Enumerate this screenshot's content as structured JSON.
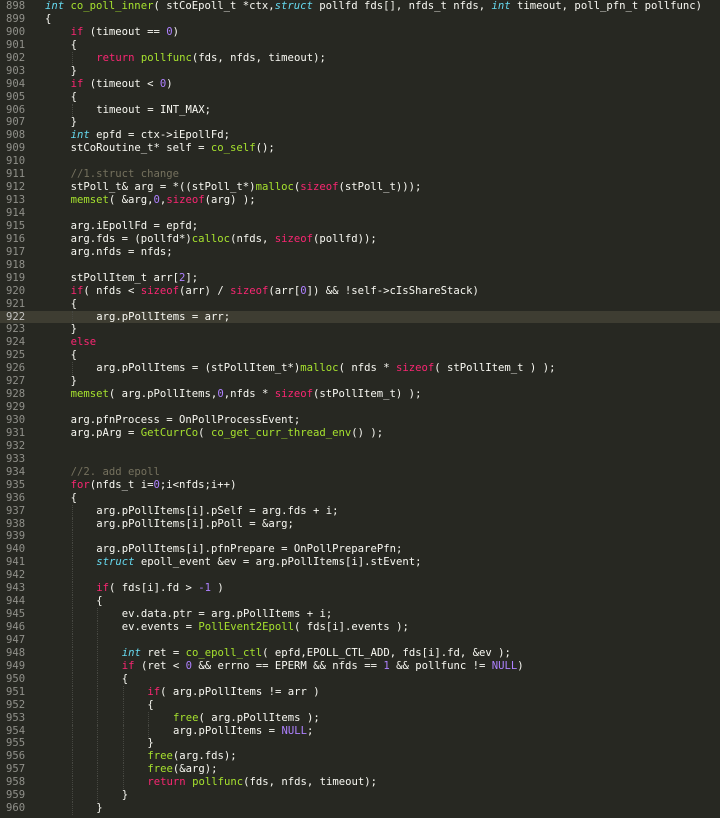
{
  "editor": {
    "theme_colors": {
      "background": "#272822",
      "current_line": "#3e3d32",
      "keyword": "#f92672",
      "type": "#66d9ef",
      "function": "#a6e22e",
      "number": "#ae81ff",
      "comment": "#75715e",
      "text": "#f8f8f2",
      "line_number": "#90908a"
    },
    "current_line_number": "922",
    "lines": [
      {
        "num": "898",
        "indent": 0,
        "tokens": [
          {
            "t": "type",
            "v": "int"
          },
          {
            "t": "plain",
            "v": " "
          },
          {
            "t": "fn",
            "v": "co_poll_inner"
          },
          {
            "t": "plain",
            "v": "( stCoEpoll_t *ctx,"
          },
          {
            "t": "type",
            "v": "struct"
          },
          {
            "t": "plain",
            "v": " pollfd fds[], nfds_t nfds, "
          },
          {
            "t": "type",
            "v": "int"
          },
          {
            "t": "plain",
            "v": " timeout, poll_pfn_t pollfunc)"
          }
        ]
      },
      {
        "num": "899",
        "indent": 0,
        "tokens": [
          {
            "t": "plain",
            "v": "{"
          }
        ]
      },
      {
        "num": "900",
        "indent": 1,
        "tokens": [
          {
            "t": "kw",
            "v": "if"
          },
          {
            "t": "plain",
            "v": " (timeout == "
          },
          {
            "t": "num",
            "v": "0"
          },
          {
            "t": "plain",
            "v": ")"
          }
        ]
      },
      {
        "num": "901",
        "indent": 1,
        "tokens": [
          {
            "t": "plain",
            "v": "{"
          }
        ]
      },
      {
        "num": "902",
        "indent": 2,
        "tokens": [
          {
            "t": "kw",
            "v": "return"
          },
          {
            "t": "plain",
            "v": " "
          },
          {
            "t": "fn",
            "v": "pollfunc"
          },
          {
            "t": "plain",
            "v": "(fds, nfds, timeout);"
          }
        ]
      },
      {
        "num": "903",
        "indent": 1,
        "tokens": [
          {
            "t": "plain",
            "v": "}"
          }
        ]
      },
      {
        "num": "904",
        "indent": 1,
        "tokens": [
          {
            "t": "kw",
            "v": "if"
          },
          {
            "t": "plain",
            "v": " (timeout < "
          },
          {
            "t": "num",
            "v": "0"
          },
          {
            "t": "plain",
            "v": ")"
          }
        ]
      },
      {
        "num": "905",
        "indent": 1,
        "tokens": [
          {
            "t": "plain",
            "v": "{"
          }
        ]
      },
      {
        "num": "906",
        "indent": 2,
        "tokens": [
          {
            "t": "plain",
            "v": "timeout = INT_MAX;"
          }
        ]
      },
      {
        "num": "907",
        "indent": 1,
        "tokens": [
          {
            "t": "plain",
            "v": "}"
          }
        ]
      },
      {
        "num": "908",
        "indent": 1,
        "tokens": [
          {
            "t": "type",
            "v": "int"
          },
          {
            "t": "plain",
            "v": " epfd = ctx->iEpollFd;"
          }
        ]
      },
      {
        "num": "909",
        "indent": 1,
        "tokens": [
          {
            "t": "plain",
            "v": "stCoRoutine_t* self = "
          },
          {
            "t": "fn",
            "v": "co_self"
          },
          {
            "t": "plain",
            "v": "();"
          }
        ]
      },
      {
        "num": "910",
        "indent": 1,
        "tokens": []
      },
      {
        "num": "911",
        "indent": 1,
        "tokens": [
          {
            "t": "cm",
            "v": "//1.struct change"
          }
        ]
      },
      {
        "num": "912",
        "indent": 1,
        "tokens": [
          {
            "t": "plain",
            "v": "stPoll_t& arg = *((stPoll_t*)"
          },
          {
            "t": "fn",
            "v": "malloc"
          },
          {
            "t": "plain",
            "v": "("
          },
          {
            "t": "kw",
            "v": "sizeof"
          },
          {
            "t": "plain",
            "v": "(stPoll_t)));"
          }
        ]
      },
      {
        "num": "913",
        "indent": 1,
        "tokens": [
          {
            "t": "fn",
            "v": "memset"
          },
          {
            "t": "plain",
            "v": "( &arg,"
          },
          {
            "t": "num",
            "v": "0"
          },
          {
            "t": "plain",
            "v": ","
          },
          {
            "t": "kw",
            "v": "sizeof"
          },
          {
            "t": "plain",
            "v": "(arg) );"
          }
        ]
      },
      {
        "num": "914",
        "indent": 1,
        "tokens": []
      },
      {
        "num": "915",
        "indent": 1,
        "tokens": [
          {
            "t": "plain",
            "v": "arg.iEpollFd = epfd;"
          }
        ]
      },
      {
        "num": "916",
        "indent": 1,
        "tokens": [
          {
            "t": "plain",
            "v": "arg.fds = (pollfd*)"
          },
          {
            "t": "fn",
            "v": "calloc"
          },
          {
            "t": "plain",
            "v": "(nfds, "
          },
          {
            "t": "kw",
            "v": "sizeof"
          },
          {
            "t": "plain",
            "v": "(pollfd));"
          }
        ]
      },
      {
        "num": "917",
        "indent": 1,
        "tokens": [
          {
            "t": "plain",
            "v": "arg.nfds = nfds;"
          }
        ]
      },
      {
        "num": "918",
        "indent": 1,
        "tokens": []
      },
      {
        "num": "919",
        "indent": 1,
        "tokens": [
          {
            "t": "plain",
            "v": "stPollItem_t arr["
          },
          {
            "t": "num",
            "v": "2"
          },
          {
            "t": "plain",
            "v": "];"
          }
        ]
      },
      {
        "num": "920",
        "indent": 1,
        "tokens": [
          {
            "t": "kw",
            "v": "if"
          },
          {
            "t": "plain",
            "v": "( nfds < "
          },
          {
            "t": "kw",
            "v": "sizeof"
          },
          {
            "t": "plain",
            "v": "(arr) / "
          },
          {
            "t": "kw",
            "v": "sizeof"
          },
          {
            "t": "plain",
            "v": "(arr["
          },
          {
            "t": "num",
            "v": "0"
          },
          {
            "t": "plain",
            "v": "]) && !self->cIsShareStack)"
          }
        ]
      },
      {
        "num": "921",
        "indent": 1,
        "tokens": [
          {
            "t": "plain",
            "v": "{"
          }
        ]
      },
      {
        "num": "922",
        "indent": 2,
        "tokens": [
          {
            "t": "plain",
            "v": "arg.pPollItems = arr;"
          }
        ]
      },
      {
        "num": "923",
        "indent": 1,
        "tokens": [
          {
            "t": "plain",
            "v": "}"
          }
        ]
      },
      {
        "num": "924",
        "indent": 1,
        "tokens": [
          {
            "t": "kw",
            "v": "else"
          }
        ]
      },
      {
        "num": "925",
        "indent": 1,
        "tokens": [
          {
            "t": "plain",
            "v": "{"
          }
        ]
      },
      {
        "num": "926",
        "indent": 2,
        "tokens": [
          {
            "t": "plain",
            "v": "arg.pPollItems = (stPollItem_t*)"
          },
          {
            "t": "fn",
            "v": "malloc"
          },
          {
            "t": "plain",
            "v": "( nfds * "
          },
          {
            "t": "kw",
            "v": "sizeof"
          },
          {
            "t": "plain",
            "v": "( stPollItem_t ) );"
          }
        ]
      },
      {
        "num": "927",
        "indent": 1,
        "tokens": [
          {
            "t": "plain",
            "v": "}"
          }
        ]
      },
      {
        "num": "928",
        "indent": 1,
        "tokens": [
          {
            "t": "fn",
            "v": "memset"
          },
          {
            "t": "plain",
            "v": "( arg.pPollItems,"
          },
          {
            "t": "num",
            "v": "0"
          },
          {
            "t": "plain",
            "v": ",nfds * "
          },
          {
            "t": "kw",
            "v": "sizeof"
          },
          {
            "t": "plain",
            "v": "(stPollItem_t) );"
          }
        ]
      },
      {
        "num": "929",
        "indent": 1,
        "tokens": []
      },
      {
        "num": "930",
        "indent": 1,
        "tokens": [
          {
            "t": "plain",
            "v": "arg.pfnProcess = OnPollProcessEvent;"
          }
        ]
      },
      {
        "num": "931",
        "indent": 1,
        "tokens": [
          {
            "t": "plain",
            "v": "arg.pArg = "
          },
          {
            "t": "fn",
            "v": "GetCurrCo"
          },
          {
            "t": "plain",
            "v": "( "
          },
          {
            "t": "fn",
            "v": "co_get_curr_thread_env"
          },
          {
            "t": "plain",
            "v": "() );"
          }
        ]
      },
      {
        "num": "932",
        "indent": 1,
        "tokens": []
      },
      {
        "num": "933",
        "indent": 1,
        "tokens": []
      },
      {
        "num": "934",
        "indent": 1,
        "tokens": [
          {
            "t": "cm",
            "v": "//2. add epoll"
          }
        ]
      },
      {
        "num": "935",
        "indent": 1,
        "tokens": [
          {
            "t": "kw",
            "v": "for"
          },
          {
            "t": "plain",
            "v": "(nfds_t i="
          },
          {
            "t": "num",
            "v": "0"
          },
          {
            "t": "plain",
            "v": ";i<nfds;i++)"
          }
        ]
      },
      {
        "num": "936",
        "indent": 1,
        "tokens": [
          {
            "t": "plain",
            "v": "{"
          }
        ]
      },
      {
        "num": "937",
        "indent": 2,
        "tokens": [
          {
            "t": "plain",
            "v": "arg.pPollItems[i].pSelf = arg.fds + i;"
          }
        ]
      },
      {
        "num": "938",
        "indent": 2,
        "tokens": [
          {
            "t": "plain",
            "v": "arg.pPollItems[i].pPoll = &arg;"
          }
        ]
      },
      {
        "num": "939",
        "indent": 2,
        "tokens": []
      },
      {
        "num": "940",
        "indent": 2,
        "tokens": [
          {
            "t": "plain",
            "v": "arg.pPollItems[i].pfnPrepare = OnPollPreparePfn;"
          }
        ]
      },
      {
        "num": "941",
        "indent": 2,
        "tokens": [
          {
            "t": "type",
            "v": "struct"
          },
          {
            "t": "plain",
            "v": " epoll_event &ev = arg.pPollItems[i].stEvent;"
          }
        ]
      },
      {
        "num": "942",
        "indent": 2,
        "tokens": []
      },
      {
        "num": "943",
        "indent": 2,
        "tokens": [
          {
            "t": "kw",
            "v": "if"
          },
          {
            "t": "plain",
            "v": "( fds[i].fd > "
          },
          {
            "t": "num",
            "v": "-1"
          },
          {
            "t": "plain",
            "v": " )"
          }
        ]
      },
      {
        "num": "944",
        "indent": 2,
        "tokens": [
          {
            "t": "plain",
            "v": "{"
          }
        ]
      },
      {
        "num": "945",
        "indent": 3,
        "tokens": [
          {
            "t": "plain",
            "v": "ev.data.ptr = arg.pPollItems + i;"
          }
        ]
      },
      {
        "num": "946",
        "indent": 3,
        "tokens": [
          {
            "t": "plain",
            "v": "ev.events = "
          },
          {
            "t": "fn",
            "v": "PollEvent2Epoll"
          },
          {
            "t": "plain",
            "v": "( fds[i].events );"
          }
        ]
      },
      {
        "num": "947",
        "indent": 3,
        "tokens": []
      },
      {
        "num": "948",
        "indent": 3,
        "tokens": [
          {
            "t": "type",
            "v": "int"
          },
          {
            "t": "plain",
            "v": " ret = "
          },
          {
            "t": "fn",
            "v": "co_epoll_ctl"
          },
          {
            "t": "plain",
            "v": "( epfd,EPOLL_CTL_ADD, fds[i].fd, &ev );"
          }
        ]
      },
      {
        "num": "949",
        "indent": 3,
        "tokens": [
          {
            "t": "kw",
            "v": "if"
          },
          {
            "t": "plain",
            "v": " (ret < "
          },
          {
            "t": "num",
            "v": "0"
          },
          {
            "t": "plain",
            "v": " && errno == EPERM && nfds == "
          },
          {
            "t": "num",
            "v": "1"
          },
          {
            "t": "plain",
            "v": " && pollfunc != "
          },
          {
            "t": "const",
            "v": "NULL"
          },
          {
            "t": "plain",
            "v": ")"
          }
        ]
      },
      {
        "num": "950",
        "indent": 3,
        "tokens": [
          {
            "t": "plain",
            "v": "{"
          }
        ]
      },
      {
        "num": "951",
        "indent": 4,
        "tokens": [
          {
            "t": "kw",
            "v": "if"
          },
          {
            "t": "plain",
            "v": "( arg.pPollItems != arr )"
          }
        ]
      },
      {
        "num": "952",
        "indent": 4,
        "tokens": [
          {
            "t": "plain",
            "v": "{"
          }
        ]
      },
      {
        "num": "953",
        "indent": 5,
        "tokens": [
          {
            "t": "fn",
            "v": "free"
          },
          {
            "t": "plain",
            "v": "( arg.pPollItems );"
          }
        ]
      },
      {
        "num": "954",
        "indent": 5,
        "tokens": [
          {
            "t": "plain",
            "v": "arg.pPollItems = "
          },
          {
            "t": "const",
            "v": "NULL"
          },
          {
            "t": "plain",
            "v": ";"
          }
        ]
      },
      {
        "num": "955",
        "indent": 4,
        "tokens": [
          {
            "t": "plain",
            "v": "}"
          }
        ]
      },
      {
        "num": "956",
        "indent": 4,
        "tokens": [
          {
            "t": "fn",
            "v": "free"
          },
          {
            "t": "plain",
            "v": "(arg.fds);"
          }
        ]
      },
      {
        "num": "957",
        "indent": 4,
        "tokens": [
          {
            "t": "fn",
            "v": "free"
          },
          {
            "t": "plain",
            "v": "(&arg);"
          }
        ]
      },
      {
        "num": "958",
        "indent": 4,
        "tokens": [
          {
            "t": "kw",
            "v": "return"
          },
          {
            "t": "plain",
            "v": " "
          },
          {
            "t": "fn",
            "v": "pollfunc"
          },
          {
            "t": "plain",
            "v": "(fds, nfds, timeout);"
          }
        ]
      },
      {
        "num": "959",
        "indent": 3,
        "tokens": [
          {
            "t": "plain",
            "v": "}"
          }
        ]
      },
      {
        "num": "960",
        "indent": 2,
        "tokens": [
          {
            "t": "plain",
            "v": "}"
          }
        ]
      }
    ]
  }
}
